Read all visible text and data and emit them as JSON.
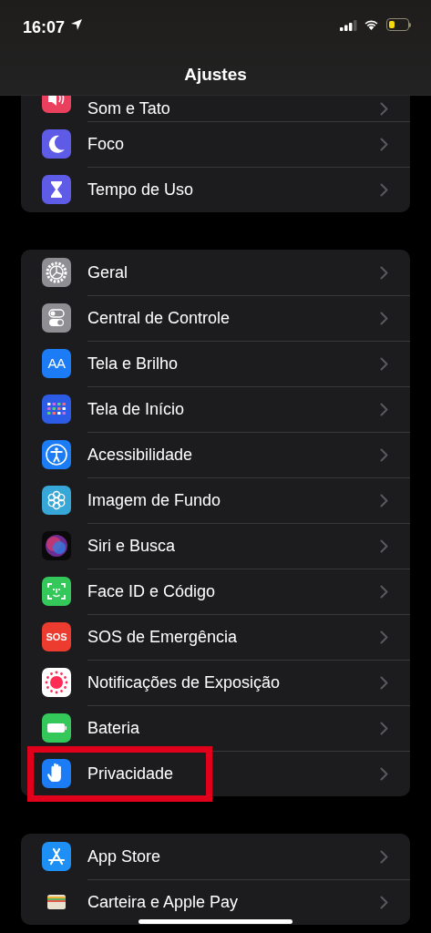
{
  "status_bar": {
    "time": "16:07"
  },
  "title": "Ajustes",
  "groups": [
    [
      {
        "label": "Som e Tato",
        "kind": "sound",
        "highlighted": false
      },
      {
        "label": "Foco",
        "kind": "moon",
        "highlighted": false
      },
      {
        "label": "Tempo de Uso",
        "kind": "hourglass",
        "highlighted": false
      }
    ],
    [
      {
        "label": "Geral",
        "kind": "gear",
        "highlighted": false
      },
      {
        "label": "Central de Controle",
        "kind": "switches",
        "highlighted": false
      },
      {
        "label": "Tela e Brilho",
        "kind": "textsize",
        "icon_text": "AA",
        "highlighted": false
      },
      {
        "label": "Tela de Início",
        "kind": "grid",
        "highlighted": false
      },
      {
        "label": "Acessibilidade",
        "kind": "accessibility",
        "highlighted": false
      },
      {
        "label": "Imagem de Fundo",
        "kind": "flower",
        "highlighted": false
      },
      {
        "label": "Siri e Busca",
        "kind": "orb",
        "highlighted": false
      },
      {
        "label": "Face ID e Código",
        "kind": "face",
        "highlighted": false
      },
      {
        "label": "SOS de Emergência",
        "kind": "sos",
        "icon_text": "SOS",
        "highlighted": false
      },
      {
        "label": "Notificações de Exposição",
        "kind": "exposure",
        "highlighted": false
      },
      {
        "label": "Bateria",
        "kind": "battery",
        "highlighted": false
      },
      {
        "label": "Privacidade",
        "kind": "hand",
        "highlighted": true
      }
    ],
    [
      {
        "label": "App Store",
        "kind": "appstore",
        "highlighted": false
      },
      {
        "label": "Carteira e Apple Pay",
        "kind": "wallet",
        "highlighted": false
      }
    ]
  ]
}
